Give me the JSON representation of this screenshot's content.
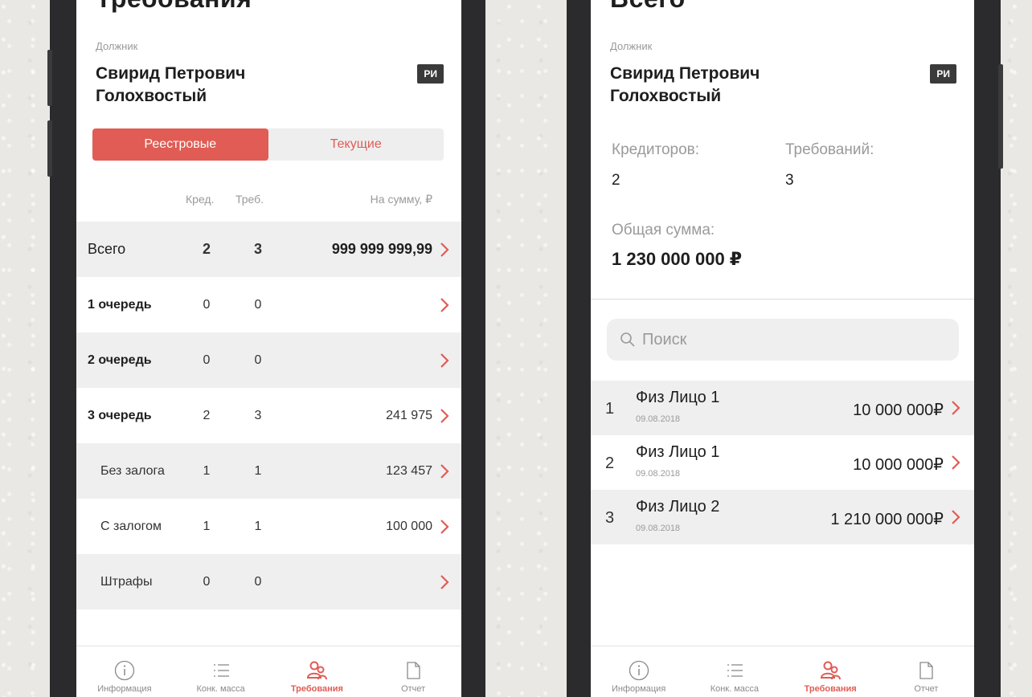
{
  "left_screen": {
    "title_partial": "Требования",
    "debtor_label": "Должник",
    "debtor_name": "Свирид Петрович Голохвостый",
    "badge": "РИ",
    "segments": [
      {
        "label": "Реестровые",
        "active": true
      },
      {
        "label": "Текущие",
        "active": false
      }
    ],
    "columns": {
      "cred": "Кред.",
      "req": "Треб.",
      "sum": "На сумму, ₽"
    },
    "rows": [
      {
        "label": "Всего",
        "cred": "2",
        "req": "3",
        "amount": "999 999 999,99"
      },
      {
        "label": "1 очередь",
        "cred": "0",
        "req": "0",
        "amount": ""
      },
      {
        "label": "2 очередь",
        "cred": "0",
        "req": "0",
        "amount": ""
      },
      {
        "label": "3 очередь",
        "cred": "2",
        "req": "3",
        "amount": "241 975"
      },
      {
        "label": "Без залога",
        "cred": "1",
        "req": "1",
        "amount": "123 457"
      },
      {
        "label": "С залогом",
        "cred": "1",
        "req": "1",
        "amount": "100 000"
      },
      {
        "label": "Штрафы",
        "cred": "0",
        "req": "0",
        "amount": ""
      }
    ]
  },
  "right_screen": {
    "title_partial": "Всего",
    "debtor_label": "Должник",
    "debtor_name": "Свирид Петрович Голохвостый",
    "badge": "РИ",
    "creditors_label": "Кредиторов:",
    "creditors_value": "2",
    "requirements_label": "Требований:",
    "requirements_value": "3",
    "total_label": "Общая сумма:",
    "total_value": "1 230 000 000 ₽",
    "search_placeholder": "Поиск",
    "creditors": [
      {
        "num": "1",
        "name": "Физ Лицо 1",
        "date": "09.08.2018",
        "amount": "10 000 000₽"
      },
      {
        "num": "2",
        "name": "Физ Лицо 1",
        "date": "09.08.2018",
        "amount": "10 000 000₽"
      },
      {
        "num": "3",
        "name": "Физ Лицо 2",
        "date": "09.08.2018",
        "amount": "1 210 000 000₽"
      }
    ]
  },
  "tabbar": {
    "items": [
      {
        "label": "Информация",
        "icon": "info-icon"
      },
      {
        "label": "Конк. масса",
        "icon": "list-icon"
      },
      {
        "label": "Требования",
        "icon": "users-icon",
        "active": true
      },
      {
        "label": "Отчет",
        "icon": "document-icon"
      }
    ]
  },
  "colors": {
    "accent": "#e05c55",
    "row_grey": "#efefef",
    "badge": "#3a3a3a"
  }
}
